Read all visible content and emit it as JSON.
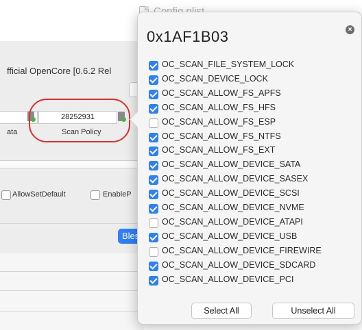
{
  "window": {
    "title": "Config.plist"
  },
  "background": {
    "row_text": "fficial OpenCore [0.6.2 Rel",
    "field_left_label": "ata",
    "scan_policy_value": "28252931",
    "scan_policy_label": "Scan Policy",
    "checkboxes": [
      "AllowSetDefault",
      "EnableP"
    ],
    "bless_label": "Bles"
  },
  "popover": {
    "title": "0x1AF1B03",
    "close_icon": "close-icon",
    "flags": [
      {
        "label": "OC_SCAN_FILE_SYSTEM_LOCK",
        "checked": true
      },
      {
        "label": "OC_SCAN_DEVICE_LOCK",
        "checked": true
      },
      {
        "label": "OC_SCAN_ALLOW_FS_APFS",
        "checked": true
      },
      {
        "label": "OC_SCAN_ALLOW_FS_HFS",
        "checked": true
      },
      {
        "label": "OC_SCAN_ALLOW_FS_ESP",
        "checked": false
      },
      {
        "label": "OC_SCAN_ALLOW_FS_NTFS",
        "checked": true
      },
      {
        "label": "OC_SCAN_ALLOW_FS_EXT",
        "checked": true
      },
      {
        "label": "OC_SCAN_ALLOW_DEVICE_SATA",
        "checked": true
      },
      {
        "label": "OC_SCAN_ALLOW_DEVICE_SASEX",
        "checked": true
      },
      {
        "label": "OC_SCAN_ALLOW_DEVICE_SCSI",
        "checked": true
      },
      {
        "label": "OC_SCAN_ALLOW_DEVICE_NVME",
        "checked": true
      },
      {
        "label": "OC_SCAN_ALLOW_DEVICE_ATAPI",
        "checked": false
      },
      {
        "label": "OC_SCAN_ALLOW_DEVICE_USB",
        "checked": true
      },
      {
        "label": "OC_SCAN_ALLOW_DEVICE_FIREWIRE",
        "checked": false
      },
      {
        "label": "OC_SCAN_ALLOW_DEVICE_SDCARD",
        "checked": true
      },
      {
        "label": "OC_SCAN_ALLOW_DEVICE_PCI",
        "checked": true
      }
    ],
    "select_all_label": "Select All",
    "unselect_all_label": "Unselect All"
  },
  "colors": {
    "accent": "#2f7ff5",
    "highlight_circle": "#d9302a"
  }
}
